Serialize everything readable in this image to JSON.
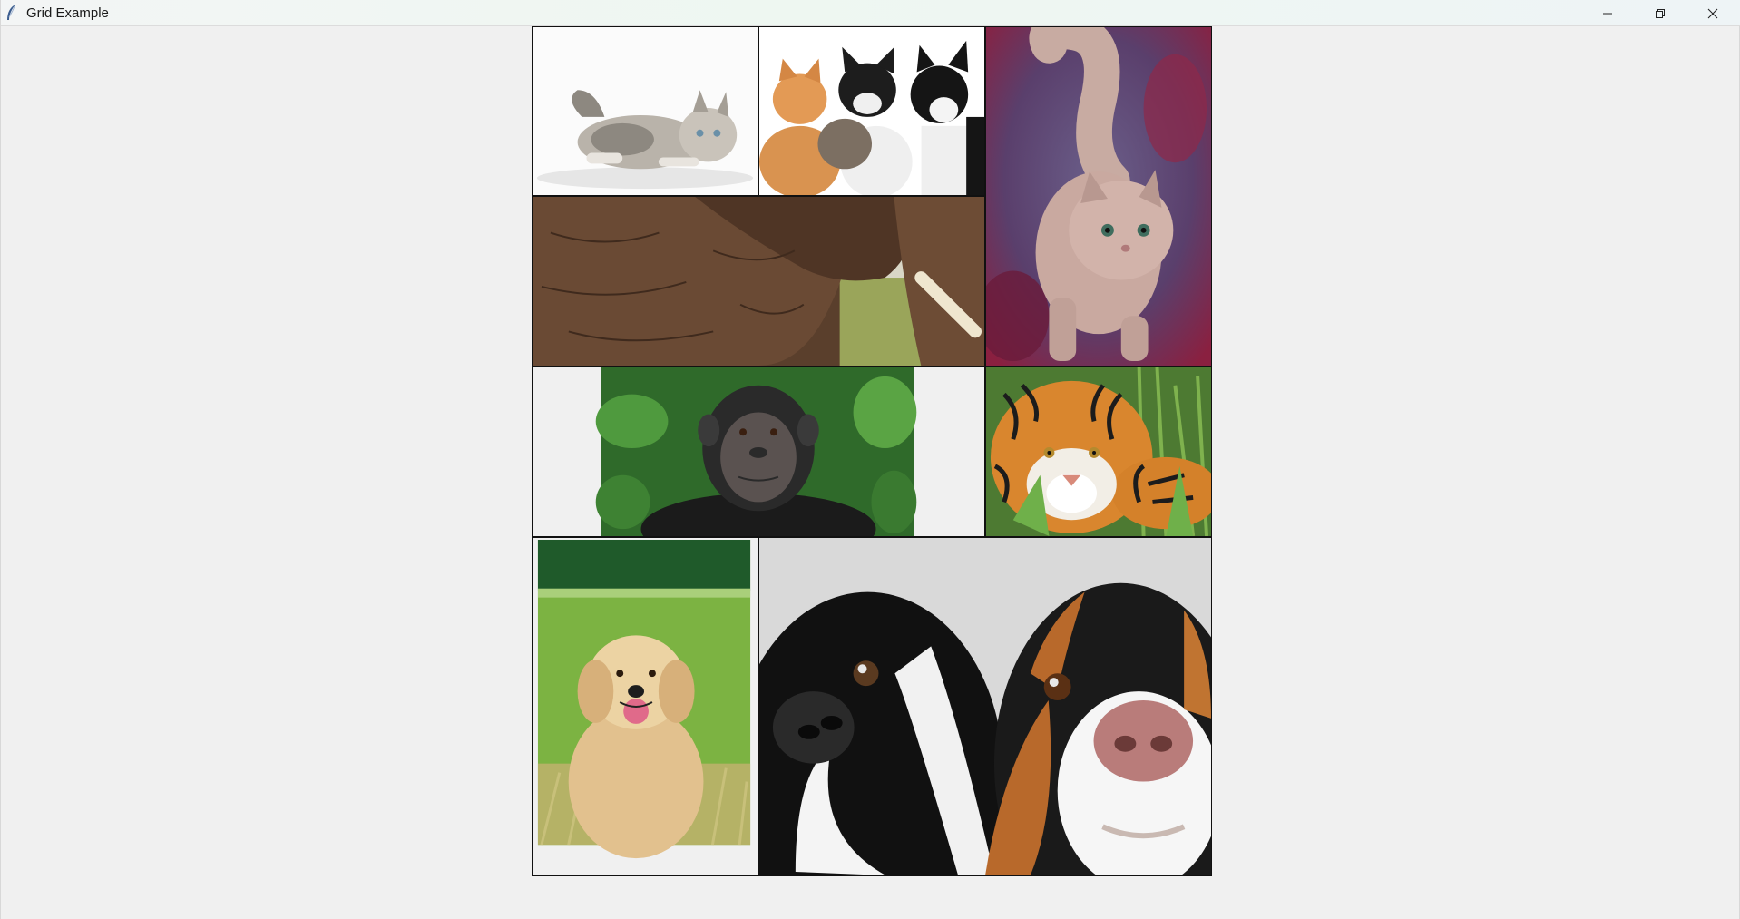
{
  "window": {
    "title": "Grid Example",
    "controls": {
      "minimize": "minimize-icon",
      "maximize": "restore-icon",
      "close": "close-icon"
    },
    "background": "#f0f0f0"
  },
  "grid": {
    "images": [
      {
        "name": "cat-lying-down",
        "description_icon": "cat"
      },
      {
        "name": "kittens-group",
        "description_icon": "kittens"
      },
      {
        "name": "fluffy-cat-standing",
        "description_icon": "cat"
      },
      {
        "name": "elephant",
        "description_icon": "elephant"
      },
      {
        "name": "chimpanzee",
        "description_icon": "chimpanzee"
      },
      {
        "name": "tiger",
        "description_icon": "tiger"
      },
      {
        "name": "golden-retriever",
        "description_icon": "dog"
      },
      {
        "name": "two-dogs-closeup",
        "description_icon": "dogs"
      }
    ]
  }
}
